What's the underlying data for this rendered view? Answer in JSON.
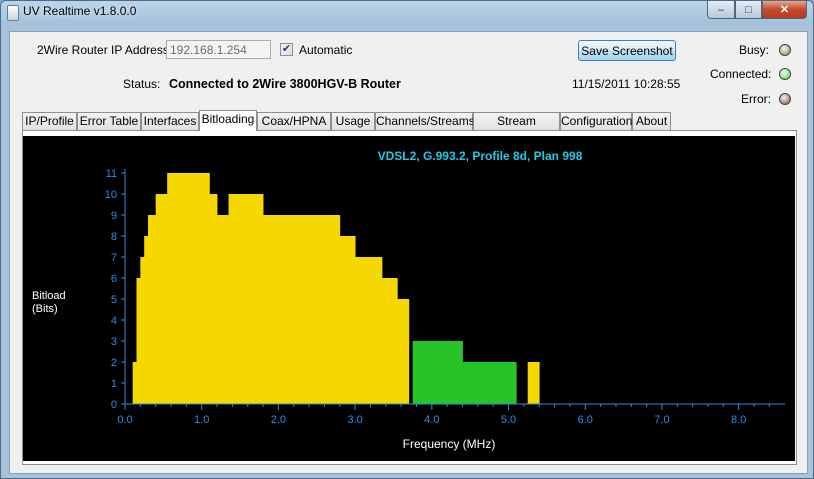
{
  "window": {
    "title": "UV Realtime v1.8.0.0",
    "minimize": "–",
    "maximize": "□",
    "close": "✕"
  },
  "header": {
    "ip_label": "2Wire Router IP Address:",
    "ip_value": "192.168.1.254",
    "automatic_label": "Automatic",
    "automatic_checked": true,
    "save_label": "Save Screenshot",
    "status_label": "Status:",
    "status_value": "Connected to 2Wire 3800HGV-B Router",
    "timestamp": "11/15/2011 10:28:55",
    "busy_label": "Busy:",
    "connected_label": "Connected:",
    "error_label": "Error:",
    "led_colors": {
      "busy": "#8c8c2a",
      "connected": "#3ee83e",
      "error": "#8c4a3a"
    }
  },
  "tabs": [
    "IP/Profile",
    "Error Table",
    "Interfaces",
    "Bitloading",
    "Coax/HPNA",
    "Usage",
    "Channels/Streams",
    "Stream Analyzer",
    "Configuration",
    "About"
  ],
  "active_tab": "Bitloading",
  "chart_data": {
    "type": "area",
    "title": "VDSL2, G.993.2, Profile 8d, Plan 998",
    "xlabel": "Frequency (MHz)",
    "ylabel": "Bitload\n(Bits)",
    "xlim": [
      0,
      8.5
    ],
    "ylim": [
      0,
      11
    ],
    "xticks": [
      "0.0",
      "1.0",
      "2.0",
      "3.0",
      "4.0",
      "5.0",
      "6.0",
      "7.0",
      "8.0"
    ],
    "yticks": [
      "0",
      "1",
      "2",
      "3",
      "4",
      "5",
      "6",
      "7",
      "8",
      "9",
      "10",
      "11"
    ],
    "colors": {
      "background": "#000000",
      "axis": "#2a8fe0",
      "title": "#23c8e8",
      "downstream": "#f5d800",
      "upstream": "#27c427"
    },
    "series": [
      {
        "band": "downstream",
        "segments": [
          [
            0.1,
            0.15,
            2
          ],
          [
            0.15,
            0.2,
            6
          ],
          [
            0.2,
            0.25,
            7
          ],
          [
            0.25,
            0.3,
            8
          ],
          [
            0.3,
            0.35,
            9
          ],
          [
            0.35,
            0.4,
            9
          ],
          [
            0.4,
            0.45,
            10
          ],
          [
            0.45,
            0.55,
            10
          ],
          [
            0.55,
            0.6,
            11
          ],
          [
            0.6,
            0.9,
            11
          ],
          [
            0.9,
            1.0,
            11
          ],
          [
            1.0,
            1.1,
            11
          ],
          [
            1.1,
            1.2,
            10
          ],
          [
            1.2,
            1.3,
            9
          ],
          [
            1.3,
            1.35,
            9
          ],
          [
            1.35,
            1.8,
            10
          ],
          [
            1.8,
            2.2,
            9
          ],
          [
            2.2,
            2.5,
            9
          ],
          [
            2.5,
            2.8,
            9
          ],
          [
            2.8,
            2.9,
            8
          ],
          [
            2.9,
            3.0,
            8
          ],
          [
            3.0,
            3.2,
            7
          ],
          [
            3.2,
            3.35,
            7
          ],
          [
            3.35,
            3.45,
            6
          ],
          [
            3.45,
            3.55,
            6
          ],
          [
            3.55,
            3.65,
            5
          ],
          [
            3.65,
            3.7,
            5
          ]
        ]
      },
      {
        "band": "upstream",
        "segments": [
          [
            3.75,
            3.8,
            3
          ],
          [
            3.8,
            4.2,
            3
          ],
          [
            4.2,
            4.4,
            3
          ],
          [
            4.4,
            4.55,
            2
          ],
          [
            4.55,
            4.8,
            2
          ],
          [
            4.8,
            5.1,
            2
          ]
        ]
      },
      {
        "band": "downstream-tail",
        "segments": [
          [
            5.25,
            5.35,
            2
          ],
          [
            5.35,
            5.4,
            2
          ]
        ]
      }
    ]
  }
}
